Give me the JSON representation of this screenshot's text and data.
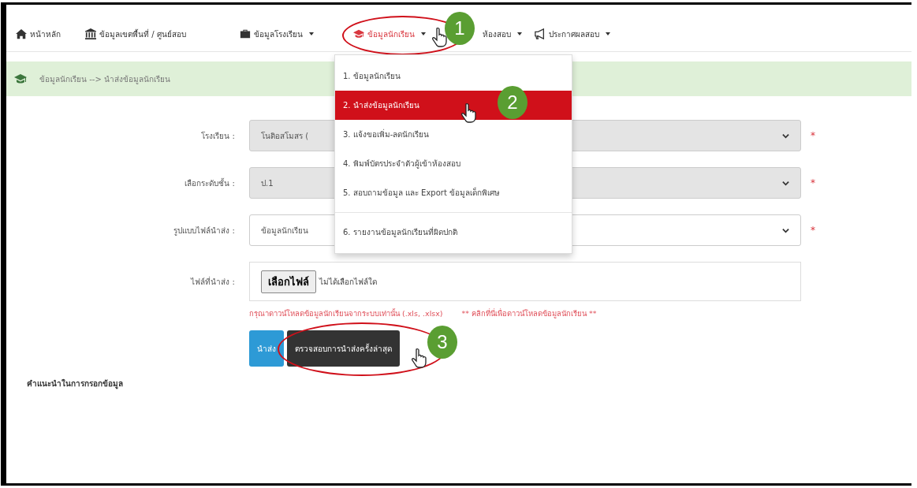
{
  "nav": [
    {
      "label": "หน้าหลัก",
      "caret": false,
      "selected": false
    },
    {
      "label": "ข้อมูลเขตพื้นที่ / ศูนย์สอบ",
      "caret": false,
      "selected": false
    },
    {
      "label": "ข้อมูลโรงเรียน",
      "caret": true,
      "selected": false
    },
    {
      "label": "ข้อมูลนักเรียน",
      "caret": true,
      "selected": true
    },
    {
      "label": "ห้องสอบ",
      "caret": true,
      "selected": false
    },
    {
      "label": "ประกาศผลสอบ",
      "caret": true,
      "selected": false
    }
  ],
  "dropdown": [
    {
      "label": "1. ข้อมูลนักเรียน",
      "selected": false
    },
    {
      "label": "2. นำส่งข้อมูลนักเรียน",
      "selected": true
    },
    {
      "label": "3. แจ้งขอเพิ่ม-ลดนักเรียน",
      "selected": false
    },
    {
      "label": "4. พิมพ์บัตรประจำตัวผู้เข้าห้องสอบ",
      "selected": false
    },
    {
      "label": "5. สอบถามข้อมูล และ Export ข้อมูลเด็กพิเศษ",
      "selected": false
    },
    {
      "label": "6. รายงานข้อมูลนักเรียนที่ผิดปกติ",
      "selected": false
    }
  ],
  "breadcrumb": "ข้อมูลนักเรียน --> นำส่งข้อมูลนักเรียน",
  "form": [
    {
      "kind": "select",
      "label": "โรงเรียน :",
      "value": "โนติอสโมสร (",
      "disabled": true,
      "required_mark": "*"
    },
    {
      "kind": "select",
      "label": "เลือกระดับชั้น :",
      "value": "ป.1",
      "disabled": true,
      "required_mark": "*"
    },
    {
      "kind": "select",
      "label": "รูปแบบไฟล์นำส่ง :",
      "value": "ข้อมูลนักเรียน",
      "disabled": false,
      "required_mark": "*"
    },
    {
      "kind": "file",
      "label": "ไฟล์ที่นำส่ง :",
      "button": "เลือกไฟล์",
      "value": "ไม่ได้เลือกไฟล์ใด"
    }
  ],
  "help_text": "กรุณาดาวน์โหลดข้อมูลนักเรียนจากระบบเท่านั้น (.xls, .xlsx)",
  "help_link": "** คลิกที่นี่เพื่อดาวน์โหลดข้อมูลนักเรียน **",
  "buttons": [
    {
      "kind": "primary",
      "label": "นำส่ง"
    },
    {
      "kind": "dark",
      "label": "ตรวจสอบการนำส่งครั้งล่าสุด"
    }
  ],
  "section_title": "คำแนะนำในการกรอกข้อมูล",
  "steps": [
    "1",
    "2",
    "3"
  ]
}
